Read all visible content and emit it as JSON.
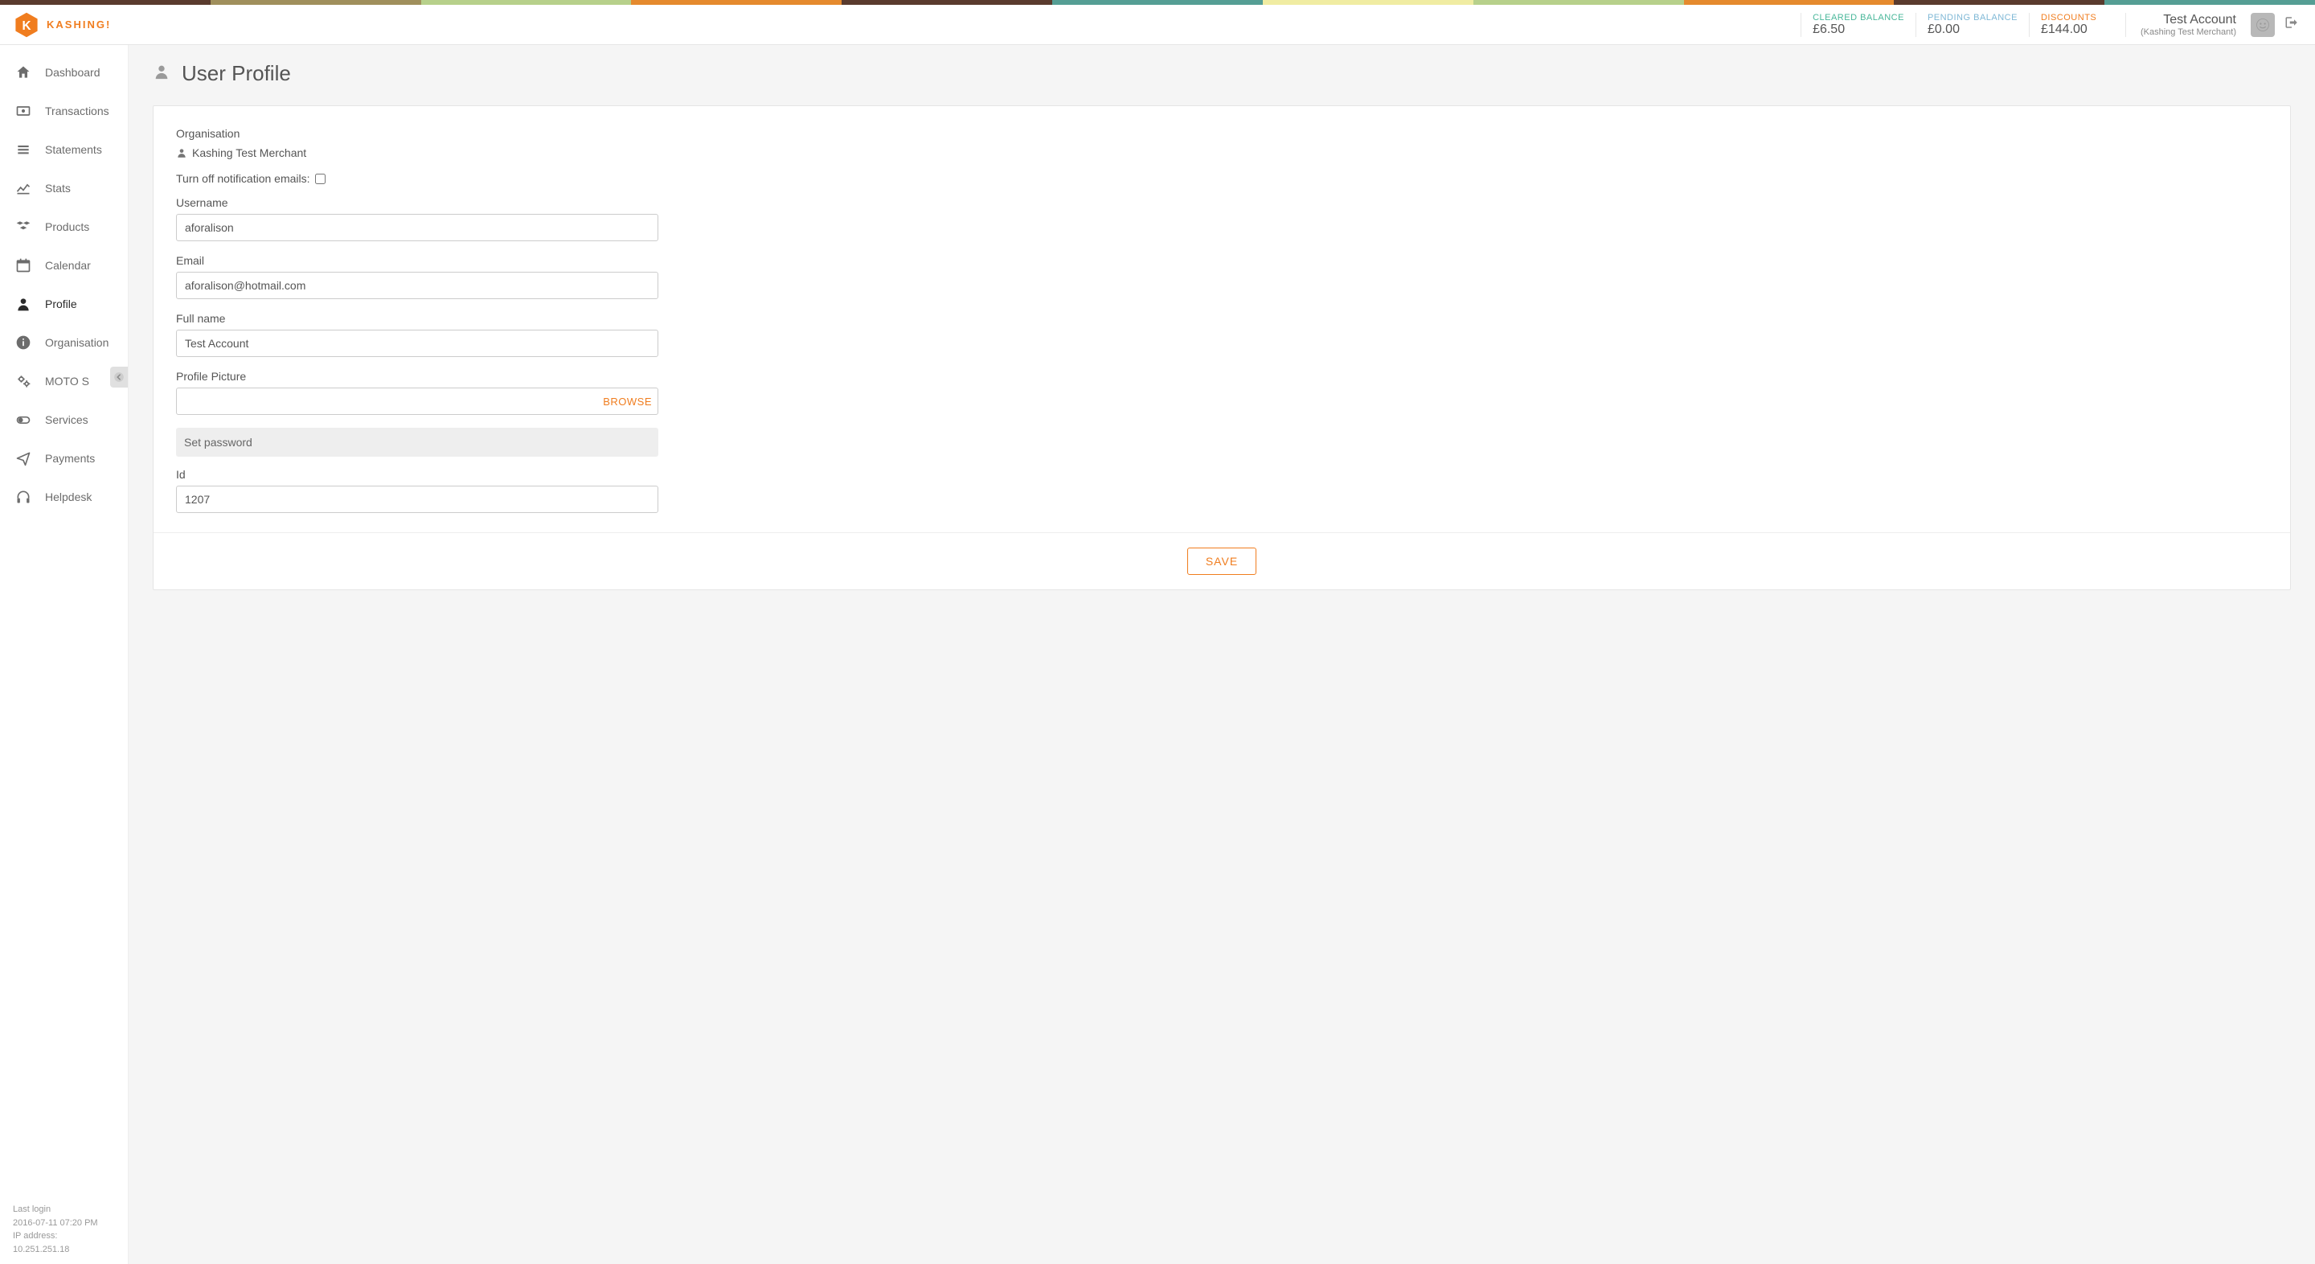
{
  "brand": "KASHING!",
  "topstrip_colors": [
    "#5a3b2e",
    "#a08f5c",
    "#b7d08b",
    "#e58a2e",
    "#5a3b2e",
    "#559e94",
    "#f0eca2",
    "#b7d08b",
    "#e58a2e",
    "#5a3b2e",
    "#559e94"
  ],
  "balances": {
    "cleared": {
      "label": "CLEARED BALANCE",
      "value": "£6.50",
      "color": "#49b79a"
    },
    "pending": {
      "label": "PENDING BALANCE",
      "value": "£0.00",
      "color": "#7fb8d6"
    },
    "discounts": {
      "label": "DISCOUNTS",
      "value": "£144.00",
      "color": "#f07d1f"
    }
  },
  "account": {
    "name": "Test Account",
    "sub": "(Kashing Test Merchant)"
  },
  "sidebar": {
    "items": [
      {
        "label": "Dashboard",
        "icon": "home"
      },
      {
        "label": "Transactions",
        "icon": "money"
      },
      {
        "label": "Statements",
        "icon": "bars"
      },
      {
        "label": "Stats",
        "icon": "chart"
      },
      {
        "label": "Products",
        "icon": "cubes"
      },
      {
        "label": "Calendar",
        "icon": "calendar"
      },
      {
        "label": "Profile",
        "icon": "user",
        "active": true
      },
      {
        "label": "Organisation",
        "icon": "info"
      },
      {
        "label": "MOTO S",
        "icon": "cogs"
      },
      {
        "label": "Services",
        "icon": "toggle"
      },
      {
        "label": "Payments",
        "icon": "plane"
      },
      {
        "label": "Helpdesk",
        "icon": "headphones"
      }
    ]
  },
  "footer": {
    "last_login_label": "Last login",
    "last_login": "2016-07-11 07:20 PM",
    "ip_label": "IP address:",
    "ip": "10.251.251.18"
  },
  "page": {
    "title": "User Profile",
    "organisation_label": "Organisation",
    "organisation_name": "Kashing Test Merchant",
    "notif_label": "Turn off notification emails:",
    "username_label": "Username",
    "username": "aforalison",
    "email_label": "Email",
    "email": "aforalison@hotmail.com",
    "fullname_label": "Full name",
    "fullname": "Test Account",
    "picture_label": "Profile Picture",
    "browse": "BROWSE",
    "setpw": "Set password",
    "id_label": "Id",
    "id": "1207",
    "save": "SAVE"
  }
}
